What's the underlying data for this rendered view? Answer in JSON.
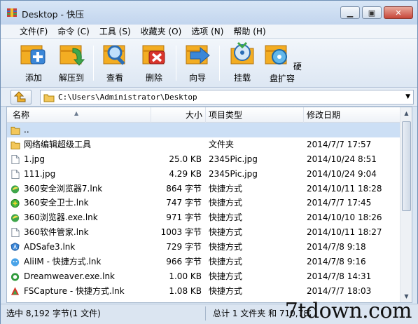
{
  "window": {
    "title": "Desktop - 快压"
  },
  "menu": [
    "文件(F)",
    "命令 (C)",
    "工具 (S)",
    "收藏夹 (O)",
    "选项 (N)",
    "帮助 (H)"
  ],
  "toolbar": {
    "add": "添加",
    "extract": "解压到",
    "view": "查看",
    "delete": "删除",
    "wizard": "向导",
    "mount": "挂载",
    "disk_expand": "硬盘扩容"
  },
  "address": {
    "path": "C:\\Users\\Administrator\\Desktop"
  },
  "columns": {
    "name": "名称",
    "size": "大小",
    "type": "项目类型",
    "modified": "修改日期"
  },
  "files": [
    {
      "name": "..",
      "size": "",
      "type": "",
      "date": "",
      "icon": "folder-icon"
    },
    {
      "name": "网络编辑超级工具",
      "size": "",
      "type": "文件夹",
      "date": "2014/7/7 17:57",
      "icon": "folder-icon"
    },
    {
      "name": "1.jpg",
      "size": "25.0 KB",
      "type": "2345Pic.jpg",
      "date": "2014/10/24 8:51",
      "icon": "file-icon"
    },
    {
      "name": "111.jpg",
      "size": "4.29 KB",
      "type": "2345Pic.jpg",
      "date": "2014/10/24 9:04",
      "icon": "file-icon"
    },
    {
      "name": "360安全浏览器7.lnk",
      "size": "864 字节",
      "type": "快捷方式",
      "date": "2014/10/11 18:28",
      "icon": "browser-icon"
    },
    {
      "name": "360安全卫士.lnk",
      "size": "747 字节",
      "type": "快捷方式",
      "date": "2014/7/7 17:45",
      "icon": "shield-icon"
    },
    {
      "name": "360浏览器.exe.lnk",
      "size": "971 字节",
      "type": "快捷方式",
      "date": "2014/10/10 18:26",
      "icon": "browser-icon"
    },
    {
      "name": "360软件管家.lnk",
      "size": "1003 字节",
      "type": "快捷方式",
      "date": "2014/10/11 18:27",
      "icon": "file-icon"
    },
    {
      "name": "ADSafe3.lnk",
      "size": "729 字节",
      "type": "快捷方式",
      "date": "2014/7/8 9:18",
      "icon": "adsafe-icon"
    },
    {
      "name": "AliIM - 快捷方式.lnk",
      "size": "966 字节",
      "type": "快捷方式",
      "date": "2014/7/8 9:16",
      "icon": "aliim-icon"
    },
    {
      "name": "Dreamweaver.exe.lnk",
      "size": "1.00 KB",
      "type": "快捷方式",
      "date": "2014/7/8 14:31",
      "icon": "dreamweaver-icon"
    },
    {
      "name": "FSCapture - 快捷方式.lnk",
      "size": "1.08 KB",
      "type": "快捷方式",
      "date": "2014/7/7 18:03",
      "icon": "fscapture-icon"
    }
  ],
  "status": {
    "left": "选中 8,192 字节(1 文件)",
    "right": "总计 1 文件夹 和 710,782"
  },
  "watermark": "7tdown.com",
  "colors": {
    "selection": "#ccdff5",
    "titlebar": "#c2d5ee",
    "toolbar_accent": "#f0a81c"
  }
}
